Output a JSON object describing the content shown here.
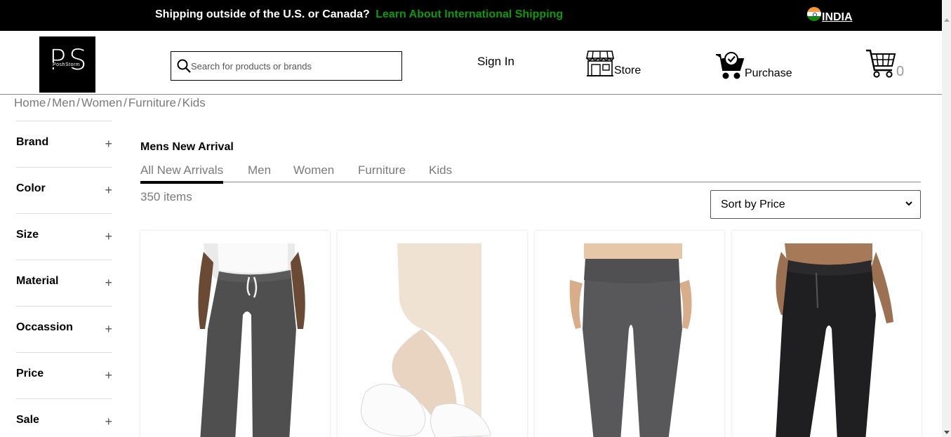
{
  "announcement": {
    "text": "Shipping outside of the U.S. or Canada?",
    "link": "Learn About International Shipping",
    "country": "INDIA"
  },
  "logo": {
    "mark": "PS",
    "subtext": "PoshStorm"
  },
  "search": {
    "placeholder": "Search for products or brands",
    "value": ""
  },
  "header": {
    "signin": "Sign In",
    "store": "Store",
    "purchase": "Purchase",
    "cart_count": "0"
  },
  "breadcrumb": [
    "Home",
    "Men",
    "Women",
    "Furniture",
    "Kids"
  ],
  "filters": [
    "Brand",
    "Color",
    "Size",
    "Material",
    "Occassion",
    "Price",
    "Sale"
  ],
  "filter_toggle": "+",
  "main": {
    "title": "Mens New Arrival",
    "tabs": [
      "All New Arrivals",
      "Men",
      "Women",
      "Furniture",
      "Kids"
    ],
    "active_tab": "All New Arrivals",
    "items_count": "350 items",
    "sort": {
      "selected": "Sort by Price"
    }
  },
  "products": [
    {
      "image": "gray-joggers"
    },
    {
      "image": "white-ankle-socks"
    },
    {
      "image": "gray-leggings"
    },
    {
      "image": "black-joggers"
    }
  ],
  "colors": {
    "topbar": "#000000",
    "link_green": "#0a9a0a",
    "muted": "#7a7a7a"
  }
}
